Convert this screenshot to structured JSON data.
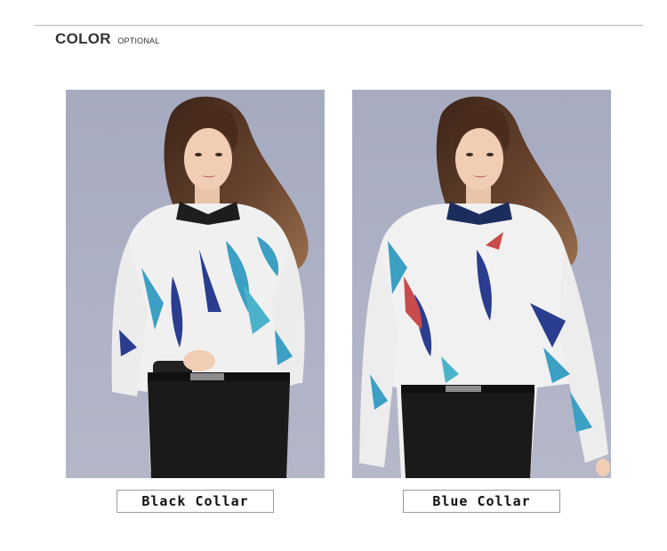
{
  "section": {
    "title": "COLOR",
    "subtitle": "OPTIONAL"
  },
  "options": [
    {
      "label": "Black Collar",
      "collar_color": "#1d1d1f",
      "image": "model-black-collar-photo"
    },
    {
      "label": "Blue Collar",
      "collar_color": "#1b2d5c",
      "image": "model-blue-collar-photo"
    }
  ],
  "colors": {
    "background": "#ffffff",
    "rule": "#b9b9b9",
    "photo_backdrop": "#a9adc1",
    "shirt": "#f2f2f2",
    "print_teal": "#3c9fc4",
    "print_navy": "#2a3d8f",
    "pants": "#1a1a1a",
    "hair": "#5a3a28"
  }
}
